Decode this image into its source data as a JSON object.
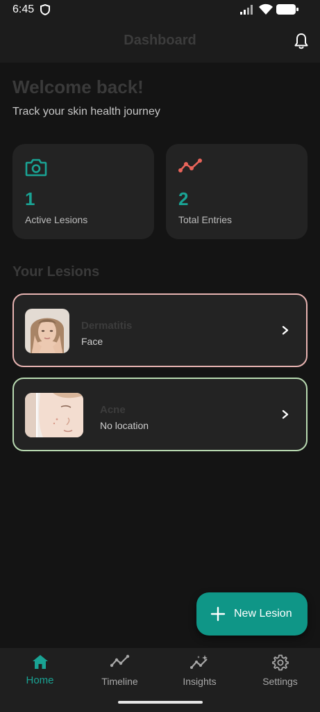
{
  "status_bar": {
    "time": "6:45"
  },
  "app_bar": {
    "title": "Dashboard"
  },
  "header": {
    "welcome": "Welcome back!",
    "subtitle": "Track your skin health journey"
  },
  "stats": [
    {
      "value": "1",
      "label": "Active Lesions",
      "icon": "camera-icon"
    },
    {
      "value": "2",
      "label": "Total Entries",
      "icon": "trend-line-icon"
    }
  ],
  "section": {
    "title": "Your Lesions"
  },
  "lesions": [
    {
      "name": "Dermatitis",
      "location": "Face",
      "border_color": "#e8b4b2"
    },
    {
      "name": "Acne",
      "location": "No location",
      "border_color": "#b9dbb2"
    }
  ],
  "fab": {
    "label": "New Lesion"
  },
  "bottom_nav": [
    {
      "label": "Home",
      "icon": "home-icon",
      "active": true
    },
    {
      "label": "Timeline",
      "icon": "timeline-icon",
      "active": false
    },
    {
      "label": "Insights",
      "icon": "insights-icon",
      "active": false
    },
    {
      "label": "Settings",
      "icon": "gear-icon",
      "active": false
    }
  ],
  "colors": {
    "accent": "#1aa394",
    "fab": "#0f9687",
    "trend": "#e8645a",
    "background": "#141414",
    "card": "#232323"
  }
}
